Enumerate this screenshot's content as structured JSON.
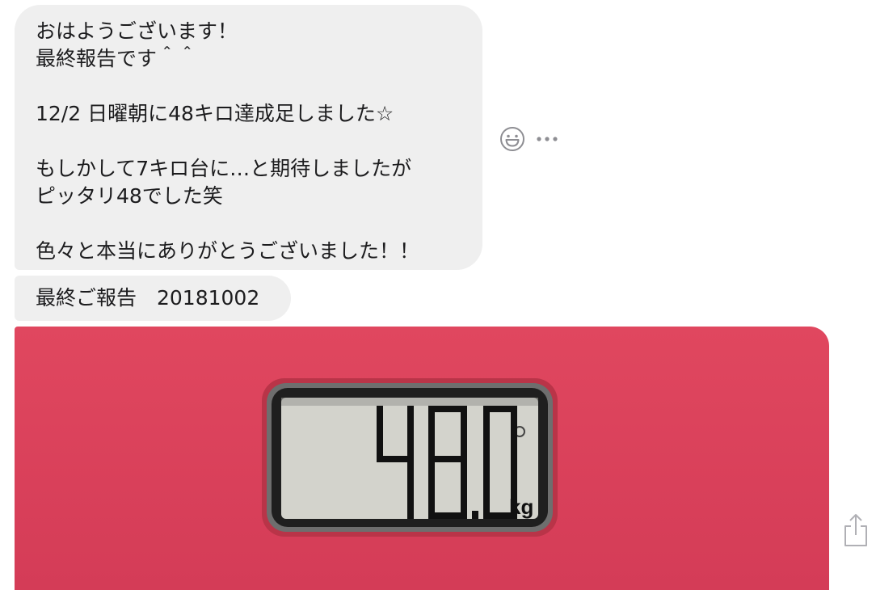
{
  "message": {
    "lines": [
      "おはようございます！",
      "最終報告です＾＾",
      "",
      "12/2 日曜朝に48キロ達成足しました☆",
      "",
      "もしかして7キロ台に…と期待しましたが",
      "ピッタリ48でした笑",
      "",
      "色々と本当にありがとうございました！！"
    ]
  },
  "caption": "最終ご報告　20181002",
  "scale": {
    "reading": "48.0",
    "unit": "kg",
    "body_color": "#dc425c",
    "display_color": "#d3d3cc"
  },
  "actions": {
    "react_icon": "smiley-face-icon",
    "more_icon": "more-dots-icon",
    "share_icon": "share-icon"
  }
}
